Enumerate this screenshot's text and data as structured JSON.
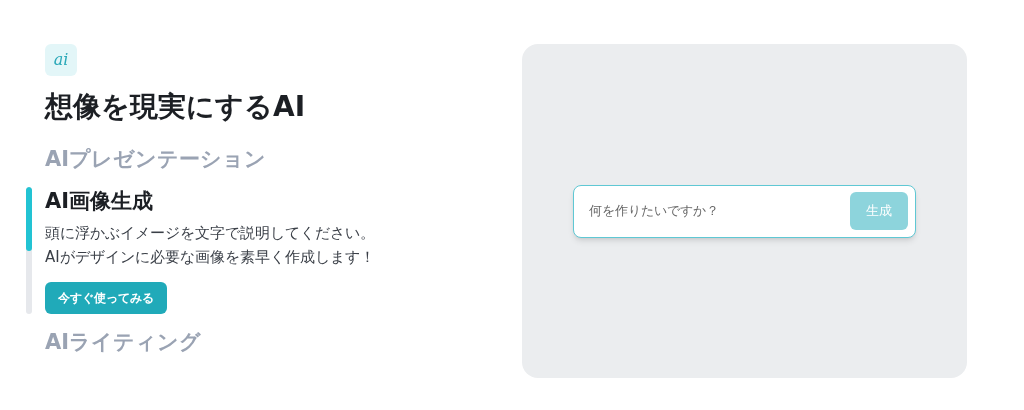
{
  "logo": {
    "text": "ai"
  },
  "heading": "想像を現実にするAI",
  "features": [
    {
      "title": "AIプレゼンテーション",
      "selected": false
    },
    {
      "title": "AI画像生成",
      "selected": true,
      "level": 0.5,
      "description": "頭に浮かぶイメージを文字で説明してください。\nAIがデザインに必要な画像を素早く作成します！",
      "button": "今すぐ使ってみる"
    },
    {
      "title": "AIライティング",
      "selected": false
    }
  ],
  "demo": {
    "placeholder": "何を作りたいですか？",
    "button": {
      "label": "生成",
      "disabled": true
    }
  }
}
